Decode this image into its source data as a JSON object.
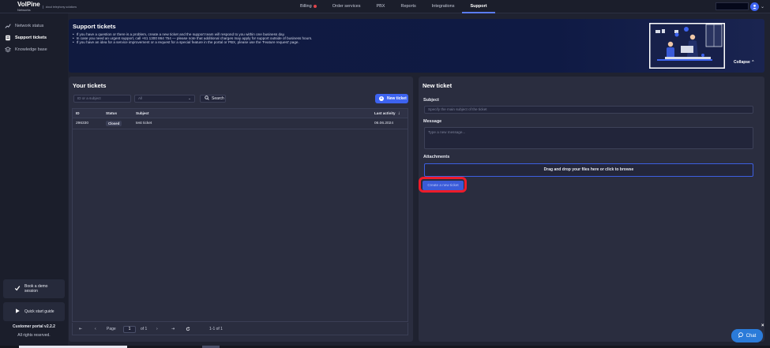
{
  "logo": {
    "name": "VolPine",
    "sub": "Networks",
    "tag": "cloud telephony solutions"
  },
  "nav": [
    {
      "label": "Billing",
      "alert": true
    },
    {
      "label": "Order services"
    },
    {
      "label": "PBX"
    },
    {
      "label": "Reports"
    },
    {
      "label": "Integrations"
    },
    {
      "label": "Support",
      "active": true
    }
  ],
  "sidebar": {
    "items": [
      {
        "label": "Network status",
        "icon": "chart-line-icon"
      },
      {
        "label": "Support tickets",
        "icon": "ticket-icon",
        "active": true
      },
      {
        "label": "Knowledge base",
        "icon": "layers-icon"
      }
    ],
    "demo": "Book a demo session",
    "guide": "Quick start guide",
    "version": "Customer portal v2.2.2",
    "rights": "All rights reserved."
  },
  "banner": {
    "title": "Support tickets",
    "lines": [
      "If you have a question or there is a problem, create a new ticket and the support team will respond to you within one business day.",
      "In case you need an urgent support, call +61 1300 864 754 — please note that additional charges may apply for support outside of business hours.",
      "If you have an idea for a service improvement or a request for a special feature in the portal or PBX, please use the 'Feature request' page."
    ],
    "collapse": "Collapse"
  },
  "tickets": {
    "title": "Your tickets",
    "search_placeholder": "ID or a subject",
    "status_filter": "All",
    "search_label": "Search",
    "new_label": "New ticket",
    "columns": [
      "ID",
      "Status",
      "Subject",
      "Last activity"
    ],
    "rows": [
      {
        "id": "296330",
        "status": "Closed",
        "subject": "test ticket",
        "last_activity": "06.06.2024"
      }
    ],
    "pager": {
      "page_label": "Page",
      "page": "1",
      "of": "of 1",
      "range": "1-1 of 1"
    }
  },
  "new_ticket": {
    "title": "New ticket",
    "subject_label": "Subject",
    "subject_placeholder": "Specify the main subject of the ticket",
    "message_label": "Message",
    "message_placeholder": "Type a new message...",
    "attachments_label": "Attachments",
    "dropzone": "Drag and drop your files here or click to browse",
    "create_label": "Create a new ticket"
  },
  "chat": {
    "label": "Chat"
  },
  "colors": {
    "accent": "#3d63f0",
    "highlight": "#ee1c2a",
    "panel": "#2a2d3f",
    "background": "#1f2230"
  }
}
